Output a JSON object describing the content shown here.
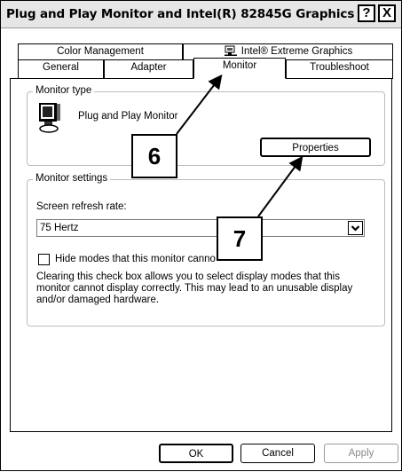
{
  "window": {
    "title": "Plug and Play Monitor and Intel(R) 82845G Graphics ...",
    "help_button": "?",
    "close_button": "X"
  },
  "tabs": {
    "row1": [
      {
        "label": "Color Management"
      },
      {
        "label": "Intel® Extreme Graphics",
        "icon": "intel-graphics-icon"
      }
    ],
    "row2": [
      {
        "label": "General"
      },
      {
        "label": "Adapter"
      },
      {
        "label": "Monitor",
        "active": true
      },
      {
        "label": "Troubleshoot"
      }
    ]
  },
  "monitor_type": {
    "group_label": "Monitor type",
    "monitor_name": "Plug and Play Monitor",
    "properties_button": "Properties"
  },
  "monitor_settings": {
    "group_label": "Monitor settings",
    "refresh_rate_label": "Screen refresh rate:",
    "refresh_rate_value": "75 Hertz",
    "hide_modes_label": "Hide modes that this monitor canno",
    "hide_modes_checked": false,
    "description_lines": [
      "Clearing this check box allows you to select display modes that this",
      "monitor cannot display correctly. This may lead to an unusable display",
      "and/or damaged hardware."
    ]
  },
  "callouts": {
    "six": "6",
    "seven": "7"
  },
  "footer": {
    "ok": "OK",
    "cancel": "Cancel",
    "apply": "Apply"
  },
  "colors": {
    "titlebar": "#e6e6e6",
    "border": "#000000",
    "group_border": "#bcbcbc",
    "disabled_text": "#8a8a8a"
  }
}
